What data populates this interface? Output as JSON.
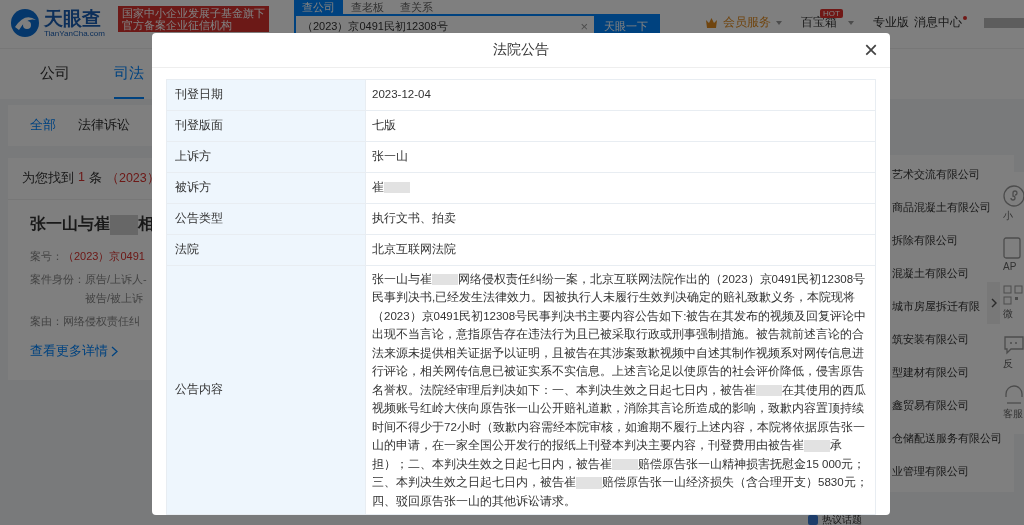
{
  "header": {
    "logo_text": "天眼查",
    "logo_sub": "TianYanCha.com",
    "banner_lines": [
      "国家中小企业发展子基金旗下",
      "官方备案企业征信机构"
    ],
    "search_tabs": [
      {
        "label": "查公司",
        "selected": true
      },
      {
        "label": "查老板",
        "selected": false
      },
      {
        "label": "查关系",
        "selected": false
      }
    ],
    "search_value": "（2023）京0491民初12308号",
    "search_clear": "×",
    "search_button": "天眼一下",
    "menu": [
      {
        "kind": "vip",
        "label": "会员服务"
      },
      {
        "kind": "box",
        "label": "百宝箱",
        "badge": "HOT"
      },
      {
        "kind": "plain",
        "label": "专业版"
      },
      {
        "kind": "msg",
        "label": "消息中心"
      }
    ]
  },
  "nav": [
    {
      "label": "公司",
      "selected": false
    },
    {
      "label": "司法",
      "selected": true
    }
  ],
  "sub_tabs": [
    {
      "label": "全部",
      "selected": true
    },
    {
      "label": "法律诉讼",
      "selected": false
    }
  ],
  "result": {
    "prefix": "为您找到",
    "count": "1",
    "unit": "条",
    "query": "（2023）"
  },
  "case_card": {
    "title": [
      {
        "kind": "text",
        "text": "张一山与崔"
      },
      {
        "kind": "redacted"
      },
      {
        "kind": "text",
        "text": "相"
      }
    ],
    "fields": [
      {
        "label": "案号：",
        "values": [
          "（2023）京0491"
        ],
        "highlight": true
      },
      {
        "label": "案件身份：",
        "values": [
          "原告/上诉人-",
          "被告/被上诉"
        ],
        "highlight": false
      },
      {
        "label": "案由：",
        "values": [
          "网络侵权责任纠"
        ],
        "highlight": false
      }
    ],
    "more_link": "查看更多详情"
  },
  "companies": [
    "艺术交流有限公司",
    "商品混凝土有限公司",
    "拆除有限公司",
    "混凝土有限公司",
    "城市房屋拆迁有限",
    "筑安装有限公司",
    "型建材有限公司",
    "鑫贸易有限公司",
    "仓储配送服务有限公司",
    "业管理有限公司"
  ],
  "side_tools": [
    {
      "kind": "miniapp",
      "label": "小"
    },
    {
      "kind": "app",
      "label": "AP"
    },
    {
      "kind": "qr",
      "label": "微"
    },
    {
      "kind": "chat",
      "label": "反"
    },
    {
      "kind": "service",
      "label": "客服"
    }
  ],
  "bottom_peek": "热议话题",
  "modal": {
    "title": "法院公告",
    "close": "×",
    "rows": [
      {
        "label": "刊登日期",
        "value": [
          {
            "kind": "text",
            "text": "2023-12-04"
          }
        ]
      },
      {
        "label": "刊登版面",
        "value": [
          {
            "kind": "text",
            "text": "七版"
          }
        ]
      },
      {
        "label": "上诉方",
        "value": [
          {
            "kind": "text",
            "text": "张一山"
          }
        ]
      },
      {
        "label": "被诉方",
        "value": [
          {
            "kind": "text",
            "text": "崔"
          },
          {
            "kind": "redacted"
          }
        ]
      },
      {
        "label": "公告类型",
        "value": [
          {
            "kind": "text",
            "text": "执行文书、拍卖"
          }
        ]
      },
      {
        "label": "法院",
        "value": [
          {
            "kind": "text",
            "text": "北京互联网法院"
          }
        ]
      },
      {
        "label": "公告内容",
        "value": [
          {
            "kind": "text",
            "text": "张一山与崔"
          },
          {
            "kind": "redacted"
          },
          {
            "kind": "text",
            "text": "网络侵权责任纠纷一案，北京互联网法院作出的（2023）京0491民初12308号民事判决书,已经发生法律效力。因被执行人未履行生效判决确定的赔礼致歉义务，本院现将（2023）京0491民初12308号民事判决书主要内容公告如下:被告在其发布的视频及回复评论中出现不当言论，意指原告存在违法行为且已被采取行政或刑事强制措施。被告就前述言论的合法来源未提供相关证据予以证明，且被告在其涉案致歉视频中自述其制作视频系对网传信息进行评论，相关网传信息已被证实系不实信息。上述言论足以使原告的社会评价降低，侵害原告名誉权。法院经审理后判决如下：一、本判决生效之日起七日内，被告崔"
          },
          {
            "kind": "redacted"
          },
          {
            "kind": "text",
            "text": "在其使用的西瓜视频账号红岭大侠向原告张一山公开赔礼道歉，消除其言论所造成的影响，致歉内容置顶持续时间不得少于72小时（致歉内容需经本院审核，如逾期不履行上述内容，本院将依据原告张一山的申请，在一家全国公开发行的报纸上刊登本判决主要内容，刊登费用由被告崔"
          },
          {
            "kind": "redacted"
          },
          {
            "kind": "text",
            "text": "承担）；二、本判决生效之日起七日内，被告崔"
          },
          {
            "kind": "redacted"
          },
          {
            "kind": "text",
            "text": "赔偿原告张一山精神损害抚慰金15 000元；三、本判决生效之日起七日内，被告崔"
          },
          {
            "kind": "redacted"
          },
          {
            "kind": "text",
            "text": "赔偿原告张一山经济损失（含合理开支）5830元；四、驳回原告张一山的其他诉讼请求。"
          }
        ]
      }
    ]
  }
}
